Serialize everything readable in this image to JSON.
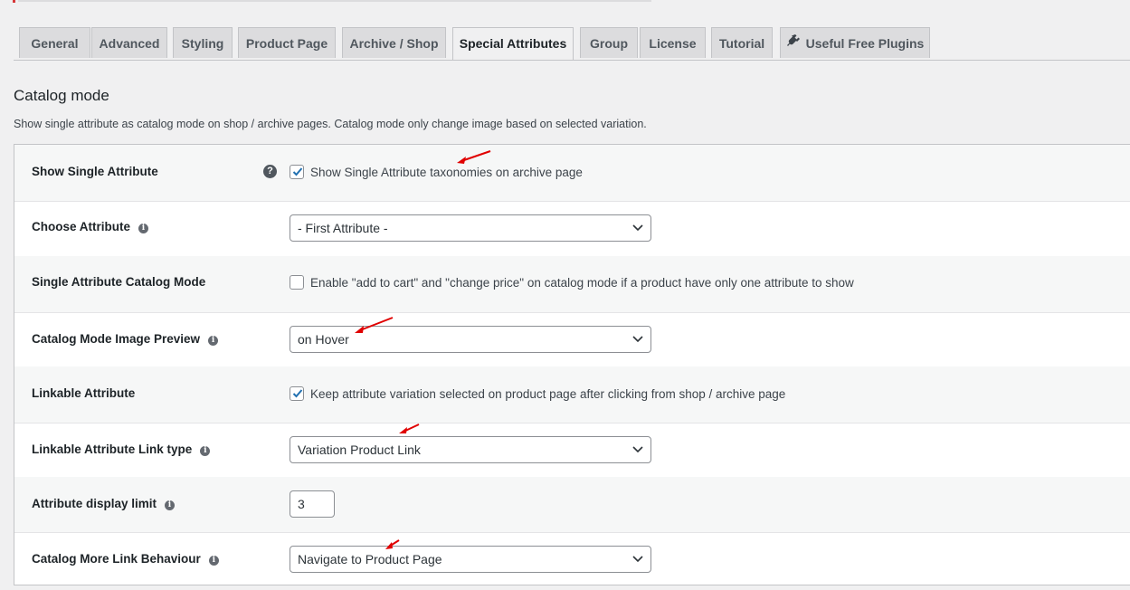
{
  "tabs": [
    {
      "label": "General"
    },
    {
      "label": "Advanced"
    },
    {
      "label": "Styling"
    },
    {
      "label": "Product Page"
    },
    {
      "label": "Archive / Shop"
    },
    {
      "label": "Special Attributes",
      "active": true
    },
    {
      "label": "Group"
    },
    {
      "label": "License"
    },
    {
      "label": "Tutorial"
    },
    {
      "label": "Useful Free Plugins",
      "icon": "plug-icon"
    }
  ],
  "section": {
    "title": "Catalog mode",
    "description": "Show single attribute as catalog mode on shop / archive pages. Catalog mode only change image based on selected variation."
  },
  "settings": {
    "show_single_attribute": {
      "label": "Show Single Attribute",
      "help": "?",
      "checked": true,
      "checkbox_label": "Show Single Attribute taxonomies on archive page"
    },
    "choose_attribute": {
      "label": "Choose Attribute",
      "value": "- First Attribute -"
    },
    "single_attribute_catalog_mode": {
      "label": "Single Attribute Catalog Mode",
      "checked": false,
      "checkbox_label": "Enable \"add to cart\" and \"change price\" on catalog mode if a product have only one attribute to show"
    },
    "catalog_mode_image_preview": {
      "label": "Catalog Mode Image Preview",
      "value": "on Hover"
    },
    "linkable_attribute": {
      "label": "Linkable Attribute",
      "checked": true,
      "checkbox_label": "Keep attribute variation selected on product page after clicking from shop / archive page"
    },
    "linkable_attribute_link_type": {
      "label": "Linkable Attribute Link type",
      "value": "Variation Product Link"
    },
    "attribute_display_limit": {
      "label": "Attribute display limit",
      "value": "3"
    },
    "catalog_more_link_behaviour": {
      "label": "Catalog More Link Behaviour",
      "value": "Navigate to Product Page"
    }
  },
  "info_icon_glyph": "i",
  "colors": {
    "checkbox_check": "#2271b1",
    "annotation_arrow": "#e00000",
    "active_tab_bg": "#f0f0f1",
    "inactive_tab_bg": "#dcdcde"
  }
}
